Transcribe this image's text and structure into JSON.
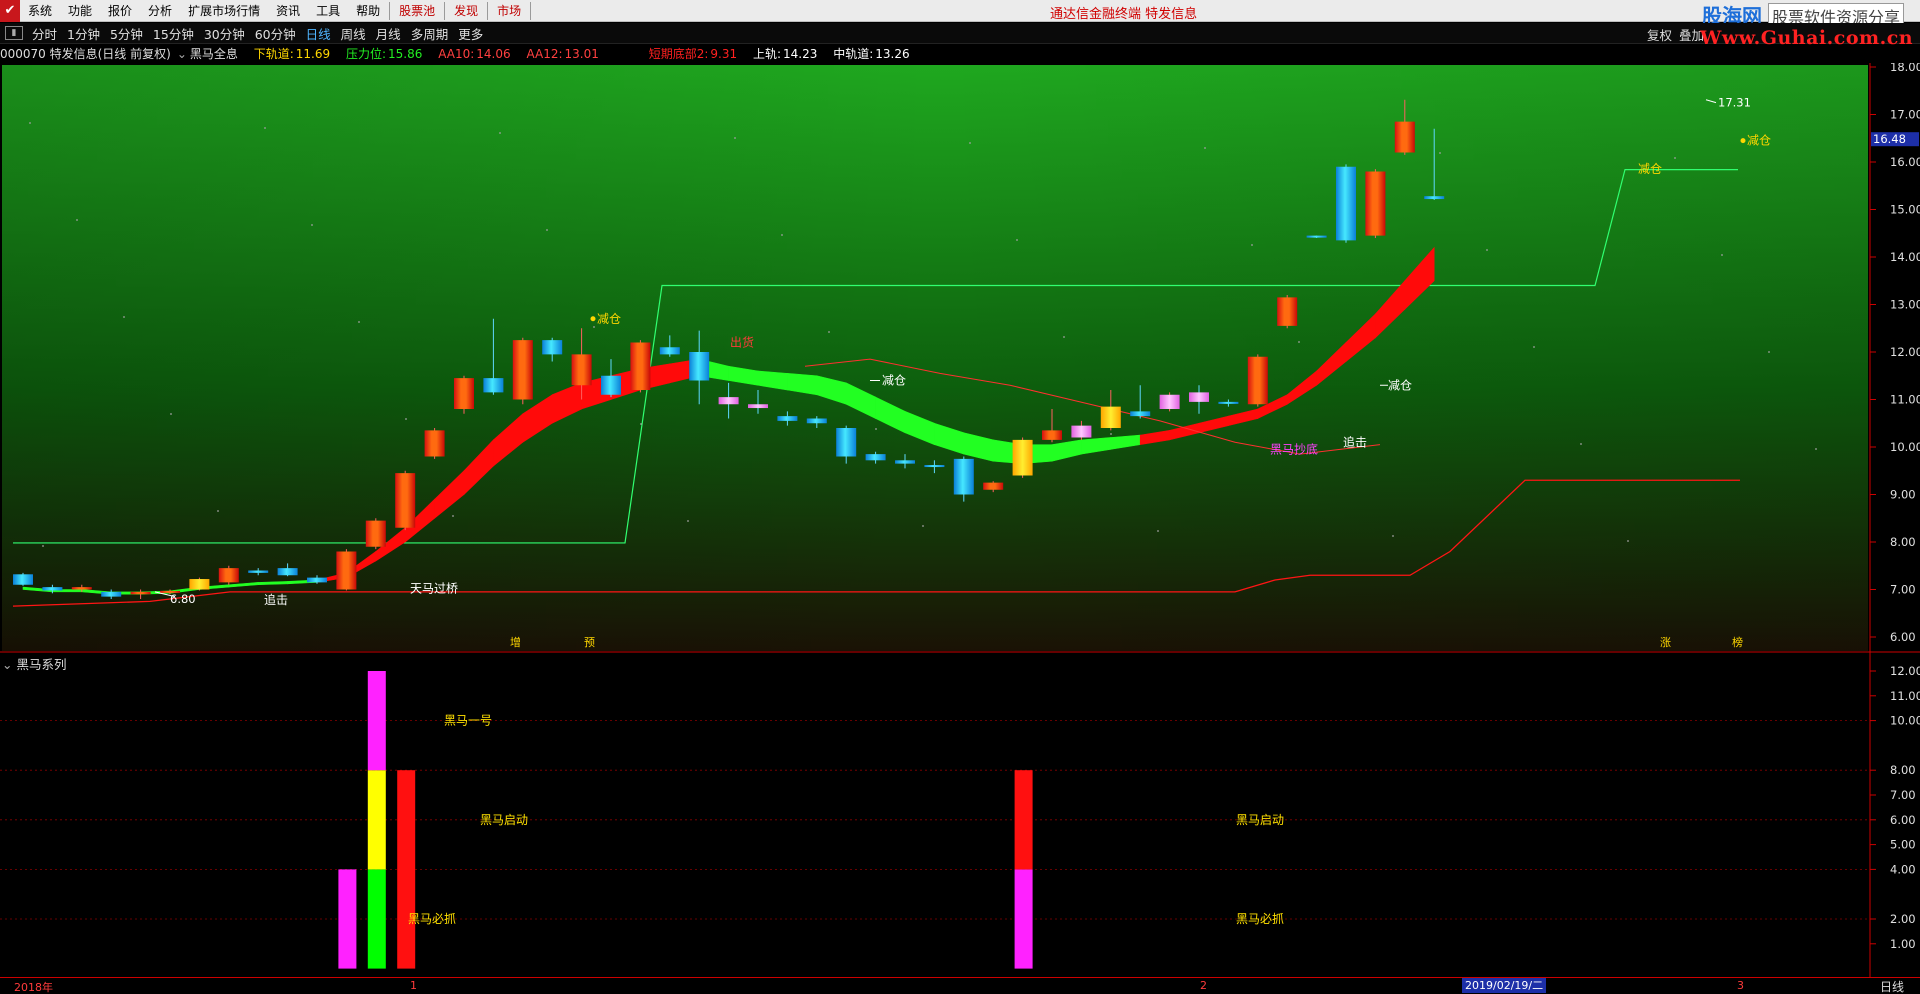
{
  "menu": {
    "items": [
      "系统",
      "功能",
      "报价",
      "分析",
      "扩展市场行情",
      "资讯",
      "工具",
      "帮助"
    ],
    "highlight_items": [
      "股票池",
      "发现",
      "市场"
    ],
    "center_title": "通达信金融终端 特发信息",
    "watermark_logo": "股海网",
    "watermark_tag": "股票软件资源分享",
    "watermark_url": "Www.Guhai.com.cn"
  },
  "periods": {
    "items": [
      "分时",
      "1分钟",
      "5分钟",
      "15分钟",
      "30分钟",
      "60分钟",
      "日线",
      "周线",
      "月线",
      "多周期",
      "更多"
    ],
    "active": "日线",
    "right_buttons": [
      "复权",
      "叠加"
    ]
  },
  "info": {
    "title": "000070 特发信息(日线 前复权)",
    "formula": "黑马全息",
    "fields": [
      {
        "label": "下轨道:",
        "value": "11.69",
        "color": "#ffd700"
      },
      {
        "label": "压力位:",
        "value": "15.86",
        "color": "#22ee22"
      },
      {
        "label": "AA10:",
        "value": "14.06",
        "color": "#ff4040"
      },
      {
        "label": "AA12:",
        "value": "13.01",
        "color": "#ff4040"
      },
      {
        "label": "短期底部2:",
        "value": "9.31",
        "color": "#ff2020"
      },
      {
        "label": "上轨:",
        "value": "14.23",
        "color": "#ffffff"
      },
      {
        "label": "中轨道:",
        "value": "13.26",
        "color": "#ffffff"
      }
    ]
  },
  "price_axis": {
    "ticks": [
      "18.00",
      "17.00",
      "16.00",
      "15.00",
      "14.00",
      "13.00",
      "12.00",
      "11.00",
      "10.00",
      "9.00",
      "8.00",
      "7.00",
      "6.00"
    ],
    "current": "16.48"
  },
  "sub_axis": {
    "ticks": [
      "12.00",
      "11.00",
      "10.00",
      "8.00",
      "7.00",
      "6.00",
      "5.00",
      "4.00",
      "2.00",
      "1.00"
    ]
  },
  "chart_annotations": {
    "low_label": "6.80",
    "high_label": "17.31",
    "zhuiji1": "追击",
    "tianma": "天马过桥",
    "jiancang1": "减仓",
    "chuhuo": "出货",
    "jiancang2": "减仓",
    "heima_bottom": "黑马抄底",
    "zhuiji2": "追击",
    "jiancang3": "减仓",
    "jiancang4": "减仓",
    "jiancang5": "减仓",
    "mark_zeng": "增",
    "mark_yu": "预",
    "mark_zhang": "涨",
    "mark_bang": "榜"
  },
  "sub_panel": {
    "title": "黑马系列",
    "labels": {
      "yihao": "黑马一号",
      "qidong1": "黑马启动",
      "bizhua1": "黑马必抓",
      "qidong2": "黑马启动",
      "bizhua2": "黑马必抓"
    }
  },
  "date_axis": {
    "labels": [
      "2018年",
      "1",
      "2",
      "3"
    ],
    "cursor_date": "2019/02/19/二",
    "period_label": "日线"
  },
  "chart_data": [
    {
      "type": "candlestick",
      "title": "000070 特发信息(日线 前复权)",
      "ylim": [
        6,
        18
      ],
      "candles": [
        {
          "o": 7.32,
          "c": 7.1,
          "h": 7.35,
          "l": 7.08
        },
        {
          "o": 7.05,
          "c": 6.98,
          "h": 7.1,
          "l": 6.92
        },
        {
          "o": 7.0,
          "c": 7.05,
          "h": 7.1,
          "l": 6.95
        },
        {
          "o": 6.95,
          "c": 6.85,
          "h": 7.0,
          "l": 6.8
        },
        {
          "o": 6.9,
          "c": 6.95,
          "h": 7.0,
          "l": 6.8
        },
        {
          "o": 6.95,
          "c": 6.97,
          "h": 7.0,
          "l": 6.9
        },
        {
          "o": 7.0,
          "c": 7.22,
          "h": 7.25,
          "l": 6.98
        },
        {
          "o": 7.15,
          "c": 7.45,
          "h": 7.5,
          "l": 7.1
        },
        {
          "o": 7.4,
          "c": 7.35,
          "h": 7.45,
          "l": 7.3
        },
        {
          "o": 7.45,
          "c": 7.3,
          "h": 7.55,
          "l": 7.28
        },
        {
          "o": 7.25,
          "c": 7.15,
          "h": 7.3,
          "l": 7.12
        },
        {
          "o": 7.0,
          "c": 7.8,
          "h": 7.85,
          "l": 6.98
        },
        {
          "o": 7.9,
          "c": 8.45,
          "h": 8.5,
          "l": 7.85
        },
        {
          "o": 8.3,
          "c": 9.45,
          "h": 9.5,
          "l": 8.25
        },
        {
          "o": 9.8,
          "c": 10.35,
          "h": 10.4,
          "l": 9.75
        },
        {
          "o": 10.8,
          "c": 11.45,
          "h": 11.5,
          "l": 10.7
        },
        {
          "o": 11.45,
          "c": 11.15,
          "h": 12.7,
          "l": 11.1
        },
        {
          "o": 11.0,
          "c": 12.25,
          "h": 12.3,
          "l": 10.9
        },
        {
          "o": 12.25,
          "c": 11.95,
          "h": 12.3,
          "l": 11.8
        },
        {
          "o": 11.3,
          "c": 11.95,
          "h": 12.5,
          "l": 11.0
        },
        {
          "o": 11.5,
          "c": 11.1,
          "h": 11.85,
          "l": 11.05
        },
        {
          "o": 11.2,
          "c": 12.2,
          "h": 12.25,
          "l": 11.15
        },
        {
          "o": 12.1,
          "c": 11.95,
          "h": 12.35,
          "l": 11.9
        },
        {
          "o": 12.0,
          "c": 11.4,
          "h": 12.45,
          "l": 10.9
        },
        {
          "o": 11.05,
          "c": 10.9,
          "h": 11.35,
          "l": 10.6
        },
        {
          "o": 10.9,
          "c": 10.82,
          "h": 11.2,
          "l": 10.7
        },
        {
          "o": 10.65,
          "c": 10.55,
          "h": 10.75,
          "l": 10.45
        },
        {
          "o": 10.6,
          "c": 10.5,
          "h": 10.65,
          "l": 10.4
        },
        {
          "o": 10.4,
          "c": 9.8,
          "h": 10.45,
          "l": 9.65
        },
        {
          "o": 9.85,
          "c": 9.72,
          "h": 9.9,
          "l": 9.65
        },
        {
          "o": 9.72,
          "c": 9.65,
          "h": 9.85,
          "l": 9.55
        },
        {
          "o": 9.62,
          "c": 9.58,
          "h": 9.72,
          "l": 9.45
        },
        {
          "o": 9.75,
          "c": 9.0,
          "h": 9.8,
          "l": 8.85
        },
        {
          "o": 9.1,
          "c": 9.25,
          "h": 9.28,
          "l": 9.05
        },
        {
          "o": 9.4,
          "c": 10.15,
          "h": 10.2,
          "l": 9.35
        },
        {
          "o": 10.15,
          "c": 10.35,
          "h": 10.8,
          "l": 10.1
        },
        {
          "o": 10.2,
          "c": 10.45,
          "h": 10.55,
          "l": 10.15
        },
        {
          "o": 10.4,
          "c": 10.85,
          "h": 11.2,
          "l": 10.35
        },
        {
          "o": 10.75,
          "c": 10.65,
          "h": 11.3,
          "l": 10.6
        },
        {
          "o": 10.8,
          "c": 11.1,
          "h": 11.15,
          "l": 10.75
        },
        {
          "o": 11.15,
          "c": 10.95,
          "h": 11.3,
          "l": 10.7
        },
        {
          "o": 10.95,
          "c": 10.92,
          "h": 11.0,
          "l": 10.85
        },
        {
          "o": 10.9,
          "c": 11.9,
          "h": 11.95,
          "l": 10.85
        },
        {
          "o": 12.55,
          "c": 13.15,
          "h": 13.2,
          "l": 12.5
        },
        {
          "o": 14.45,
          "c": 14.42,
          "h": 14.45,
          "l": 14.4
        },
        {
          "o": 15.9,
          "c": 14.35,
          "h": 15.95,
          "l": 14.3
        },
        {
          "o": 14.45,
          "c": 15.8,
          "h": 15.85,
          "l": 14.4
        },
        {
          "o": 16.2,
          "c": 16.85,
          "h": 17.31,
          "l": 16.15
        },
        {
          "o": 15.28,
          "c": 15.22,
          "h": 16.7,
          "l": 15.2
        }
      ],
      "lower_band": [
        7.0,
        6.95,
        6.95,
        6.9,
        6.9,
        6.92,
        7.0,
        7.05,
        7.1,
        7.12,
        7.15,
        7.25,
        7.6,
        8.0,
        8.5,
        9.0,
        9.6,
        10.1,
        10.5,
        10.8,
        11.0,
        11.2,
        11.35,
        11.5,
        11.4,
        11.3,
        11.2,
        11.1,
        10.9,
        10.6,
        10.3,
        10.05,
        9.85,
        9.7,
        9.65,
        9.7,
        9.85,
        9.95,
        10.05,
        10.15,
        10.3,
        10.45,
        10.6,
        10.9,
        11.3,
        11.8,
        12.3,
        12.9,
        13.5
      ],
      "ribbon_width": [
        0.05,
        0.05,
        0.05,
        0.05,
        0.05,
        0.05,
        0.05,
        0.05,
        0.05,
        0.05,
        0.05,
        0.1,
        0.2,
        0.3,
        0.4,
        0.5,
        0.55,
        0.6,
        0.6,
        0.55,
        0.5,
        0.45,
        0.4,
        0.35,
        0.3,
        0.3,
        0.35,
        0.4,
        0.45,
        0.45,
        0.45,
        0.45,
        0.45,
        0.45,
        0.4,
        0.35,
        0.3,
        0.25,
        0.2,
        0.2,
        0.2,
        0.2,
        0.2,
        0.2,
        0.3,
        0.4,
        0.5,
        0.6,
        0.7
      ],
      "ribbon_color_up": [
        0,
        0,
        0,
        0,
        0,
        0,
        0,
        0,
        0,
        0,
        0,
        1,
        1,
        1,
        1,
        1,
        1,
        1,
        1,
        1,
        1,
        1,
        1,
        1,
        0,
        0,
        0,
        0,
        0,
        0,
        0,
        0,
        0,
        0,
        0,
        0,
        0,
        0,
        0,
        1,
        1,
        1,
        1,
        1,
        1,
        1,
        1,
        1,
        1
      ]
    },
    {
      "type": "bar",
      "title": "黑马系列",
      "ylim": [
        0,
        12
      ],
      "bars": [
        {
          "index": 11,
          "segments": [
            {
              "from": 0,
              "to": 4,
              "color": "#ff22ff"
            }
          ]
        },
        {
          "index": 12,
          "segments": [
            {
              "from": 0,
              "to": 4,
              "color": "#00ff00"
            },
            {
              "from": 4,
              "to": 8,
              "color": "#ffff00"
            },
            {
              "from": 8,
              "to": 12,
              "color": "#ff22ff"
            }
          ]
        },
        {
          "index": 13,
          "segments": [
            {
              "from": 0,
              "to": 8,
              "color": "#ff1010"
            }
          ]
        },
        {
          "index": 34,
          "segments": [
            {
              "from": 0,
              "to": 4,
              "color": "#ff22ff"
            },
            {
              "from": 4,
              "to": 8,
              "color": "#ff1010"
            }
          ]
        }
      ]
    }
  ]
}
